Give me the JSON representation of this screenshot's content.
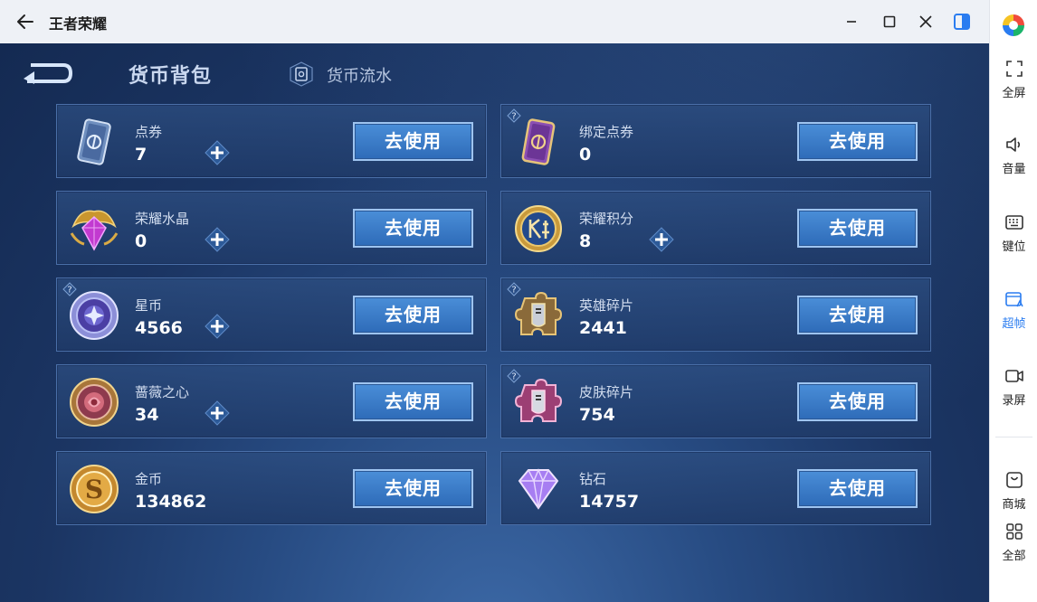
{
  "window": {
    "title": "王者荣耀"
  },
  "sidebar": {
    "items": [
      {
        "label": "全屏",
        "icon": "fullscreen-icon"
      },
      {
        "label": "音量",
        "icon": "volume-icon"
      },
      {
        "label": "键位",
        "icon": "keyboard-icon"
      },
      {
        "label": "超帧",
        "icon": "superframe-icon"
      },
      {
        "label": "录屏",
        "icon": "record-icon"
      },
      {
        "label": "商城",
        "icon": "store-icon"
      },
      {
        "label": "全部",
        "icon": "grid-icon"
      }
    ],
    "active_color": "#2a7cf0"
  },
  "game": {
    "tabs": {
      "bag": "货币背包",
      "flow": "货币流水"
    },
    "use_label": "去使用",
    "cards": [
      {
        "label": "点券",
        "value": "7",
        "icon": "coupon-icon"
      },
      {
        "label": "绑定点券",
        "value": "0",
        "icon": "bound-coupon-icon"
      },
      {
        "label": "荣耀水晶",
        "value": "0",
        "icon": "glory-crystal-icon"
      },
      {
        "label": "荣耀积分",
        "value": "8",
        "icon": "glory-points-icon"
      },
      {
        "label": "星币",
        "value": "4566",
        "icon": "star-coin-icon"
      },
      {
        "label": "英雄碎片",
        "value": "2441",
        "icon": "hero-fragment-icon"
      },
      {
        "label": "蔷薇之心",
        "value": "34",
        "icon": "rose-heart-icon"
      },
      {
        "label": "皮肤碎片",
        "value": "754",
        "icon": "skin-fragment-icon"
      },
      {
        "label": "金币",
        "value": "134862",
        "icon": "gold-coin-icon"
      },
      {
        "label": "钻石",
        "value": "14757",
        "icon": "diamond-icon"
      }
    ]
  }
}
